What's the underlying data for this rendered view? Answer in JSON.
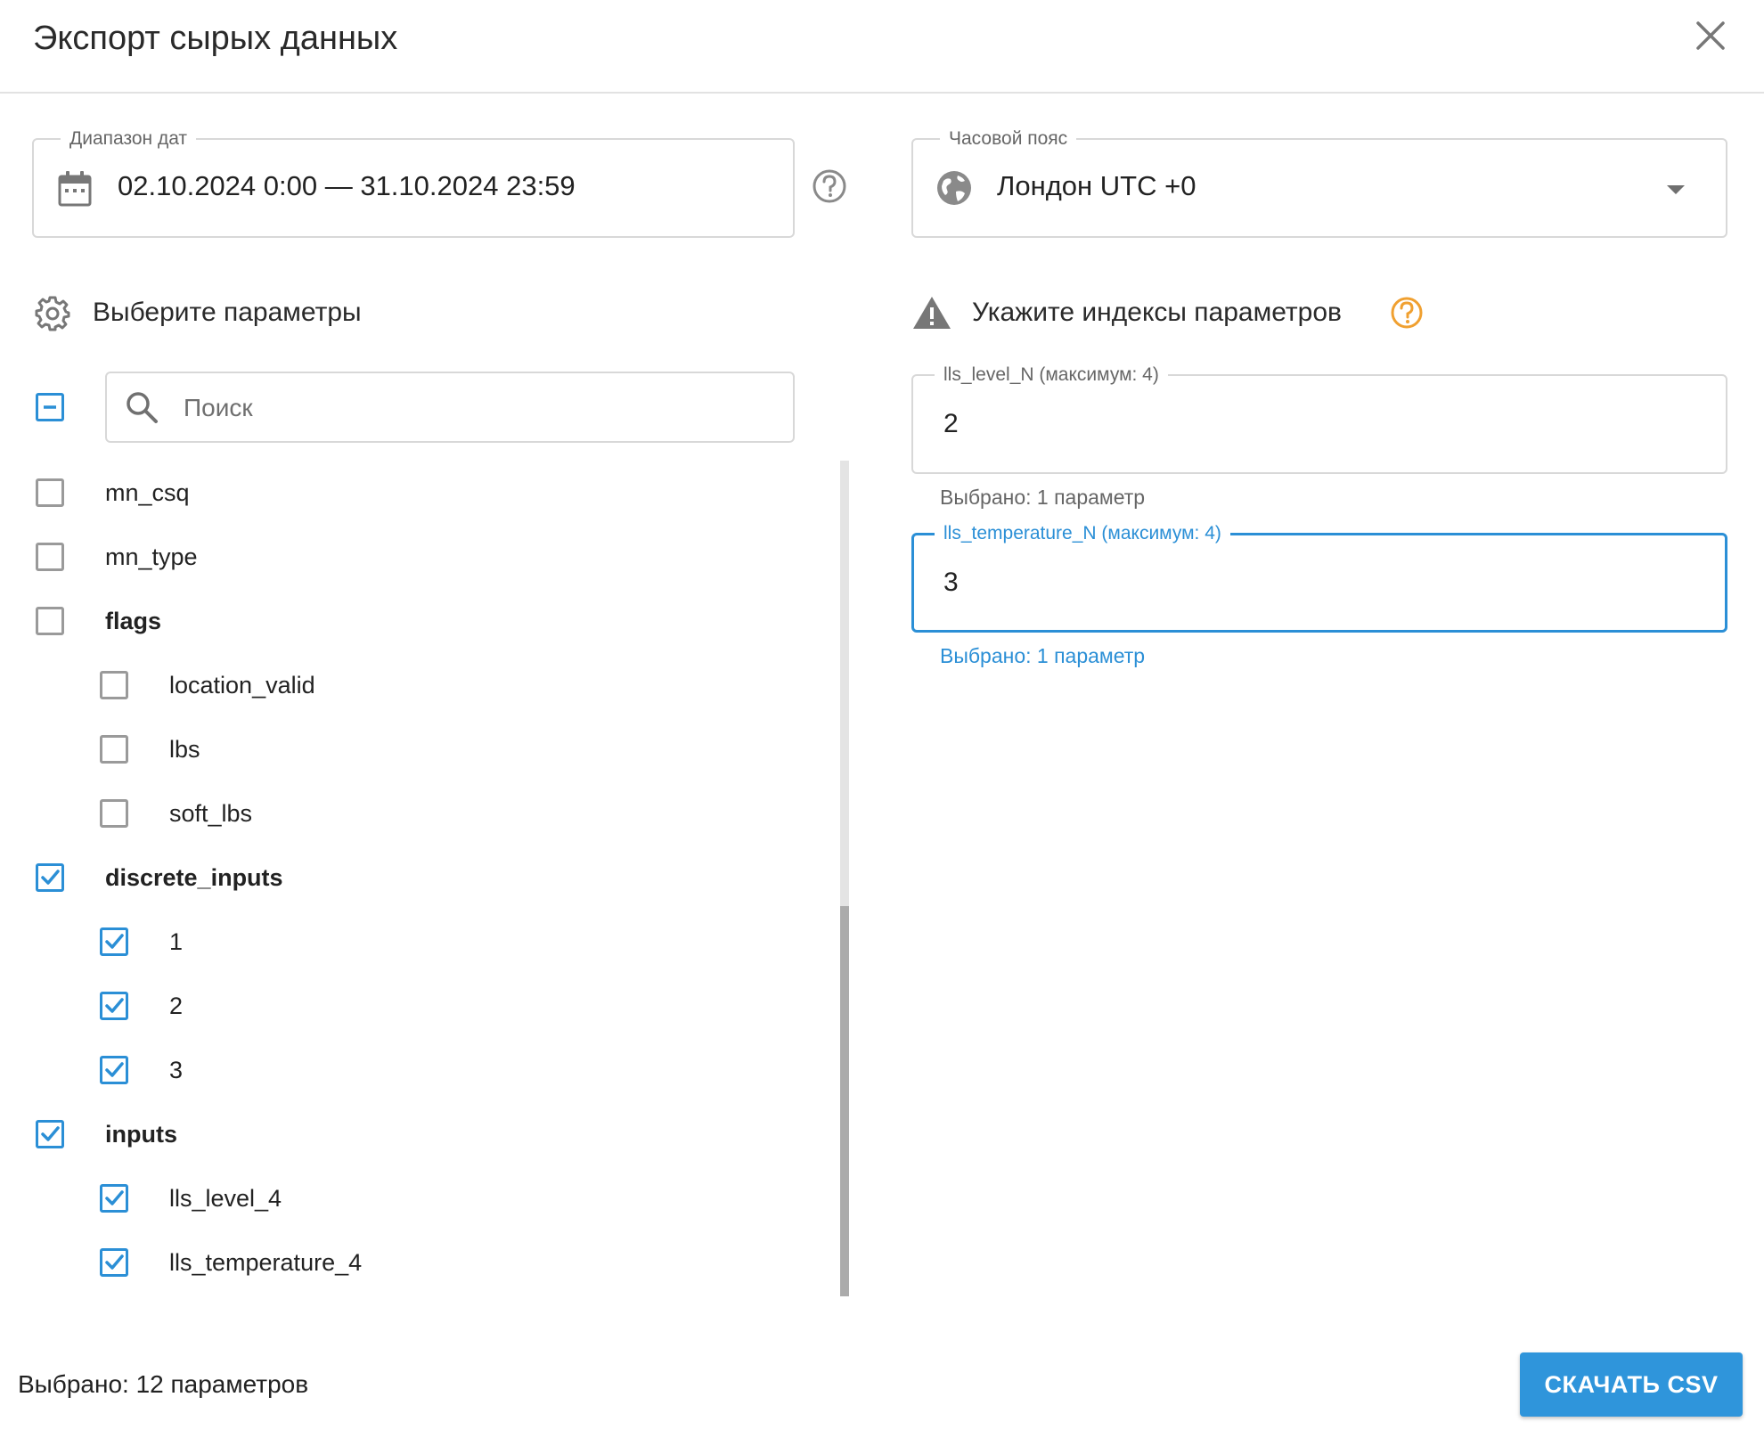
{
  "dialog": {
    "title": "Экспорт сырых данных"
  },
  "date_range": {
    "label": "Диапазон дат",
    "value": "02.10.2024 0:00 — 31.10.2024 23:59"
  },
  "timezone": {
    "label": "Часовой пояс",
    "value": "Лондон UTC +0"
  },
  "params_section": {
    "title": "Выберите параметры"
  },
  "indexes_section": {
    "title": "Укажите индексы параметров"
  },
  "search": {
    "placeholder": "Поиск",
    "value": ""
  },
  "params": [
    {
      "label": "mn_csq",
      "checked": false,
      "group": false,
      "level": 0
    },
    {
      "label": "mn_type",
      "checked": false,
      "group": false,
      "level": 0
    },
    {
      "label": "flags",
      "checked": false,
      "group": true,
      "level": 0
    },
    {
      "label": "location_valid",
      "checked": false,
      "group": false,
      "level": 1
    },
    {
      "label": "lbs",
      "checked": false,
      "group": false,
      "level": 1
    },
    {
      "label": "soft_lbs",
      "checked": false,
      "group": false,
      "level": 1
    },
    {
      "label": "discrete_inputs",
      "checked": true,
      "group": true,
      "level": 0
    },
    {
      "label": "1",
      "checked": true,
      "group": false,
      "level": 1
    },
    {
      "label": "2",
      "checked": true,
      "group": false,
      "level": 1
    },
    {
      "label": "3",
      "checked": true,
      "group": false,
      "level": 1
    },
    {
      "label": "inputs",
      "checked": true,
      "group": true,
      "level": 0
    },
    {
      "label": "lls_level_4",
      "checked": true,
      "group": false,
      "level": 1
    },
    {
      "label": "lls_temperature_4",
      "checked": true,
      "group": false,
      "level": 1
    }
  ],
  "index_fields": [
    {
      "label": "lls_level_N (максимум: 4)",
      "value": "2",
      "helper": "Выбрано: 1 параметр",
      "focused": false
    },
    {
      "label": "lls_temperature_N (максимум: 4)",
      "value": "3",
      "helper": "Выбрано: 1 параметр",
      "focused": true
    }
  ],
  "footer": {
    "selected_count": "Выбрано: 12 параметров",
    "download_label": "СКАЧАТЬ CSV"
  },
  "colors": {
    "accent": "#2b8fd6",
    "warning_icon": "#f0a030",
    "button": "#2f95db"
  },
  "icons": {
    "close": "close-icon",
    "calendar": "calendar-icon",
    "help": "help-circle-icon",
    "globe": "globe-icon",
    "dropdown": "chevron-down-icon",
    "gear": "gear-icon",
    "warning": "warning-icon",
    "search": "search-icon"
  }
}
